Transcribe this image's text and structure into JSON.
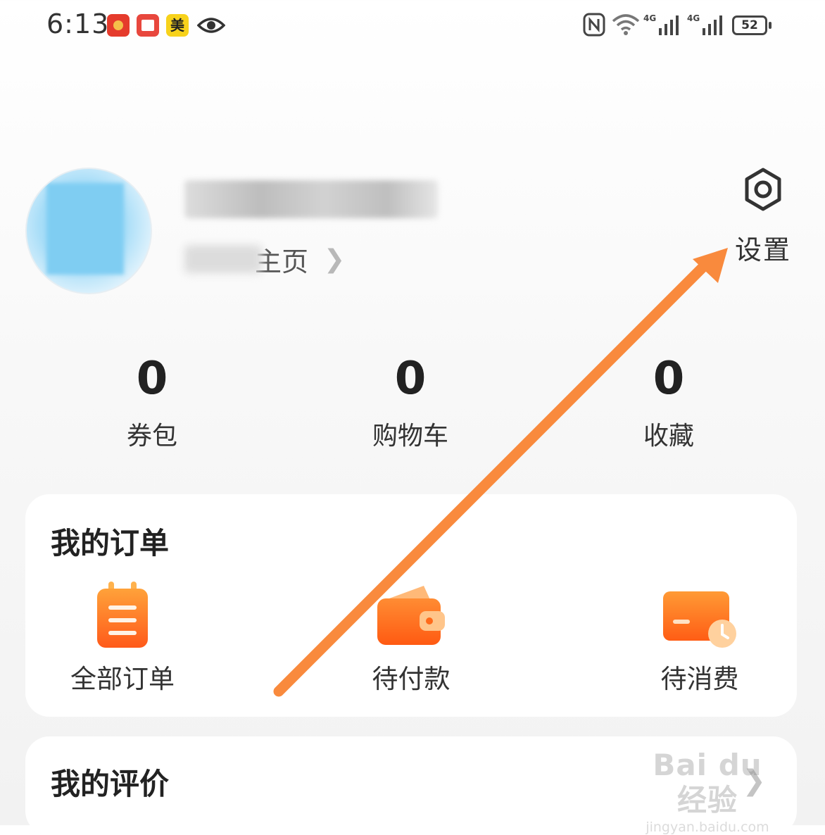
{
  "status_bar": {
    "time": "6:13",
    "notification_icons": [
      "red-packet-icon",
      "book-app-icon",
      "meituan-icon",
      "eye-icon"
    ],
    "meituan_glyph": "美",
    "network_label_1": "4G",
    "network_label_2": "4G",
    "battery": "52"
  },
  "profile": {
    "homepage_label": "主页",
    "settings_label": "设置"
  },
  "stats": [
    {
      "value": "0",
      "label": "券包"
    },
    {
      "value": "0",
      "label": "购物车"
    },
    {
      "value": "0",
      "label": "收藏"
    }
  ],
  "orders": {
    "title": "我的订单",
    "items": [
      {
        "label": "全部订单",
        "icon": "order-list-icon"
      },
      {
        "label": "待付款",
        "icon": "wallet-icon"
      },
      {
        "label": "待消费",
        "icon": "card-clock-icon"
      }
    ]
  },
  "reviews": {
    "title": "我的评价"
  },
  "watermark": {
    "logo": "Bai du 经验",
    "url": "jingyan.baidu.com"
  },
  "colors": {
    "accent_orange": "#ff6a1a",
    "arrow_orange": "#f98a3d"
  }
}
